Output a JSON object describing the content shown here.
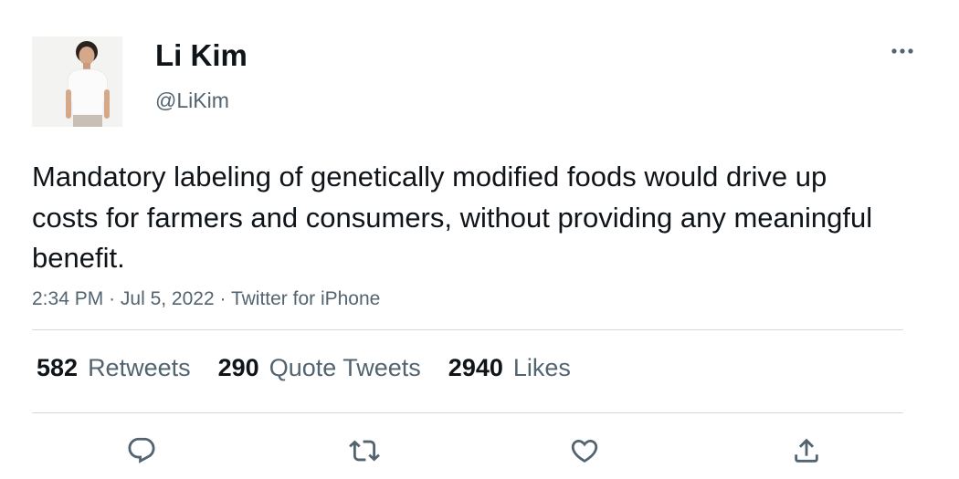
{
  "author": {
    "name": "Li Kim",
    "handle": "@LiKim"
  },
  "tweet": {
    "text": "Mandatory labeling of genetically modified foods would drive up costs for farmers and consumers, without providing any meaningful benefit.",
    "time": "2:34 PM",
    "date": "Jul 5, 2022",
    "source": "Twitter for iPhone"
  },
  "stats": {
    "retweets": {
      "count": "582",
      "label": "Retweets"
    },
    "quotes": {
      "count": "290",
      "label": "Quote Tweets"
    },
    "likes": {
      "count": "2940",
      "label": "Likes"
    }
  },
  "icons": {
    "more": "more-icon",
    "reply": "reply-icon",
    "retweet": "retweet-icon",
    "like": "heart-icon",
    "share": "share-icon"
  },
  "colors": {
    "text_primary": "#0f1419",
    "text_secondary": "#536471",
    "divider": "#cfd9de"
  }
}
